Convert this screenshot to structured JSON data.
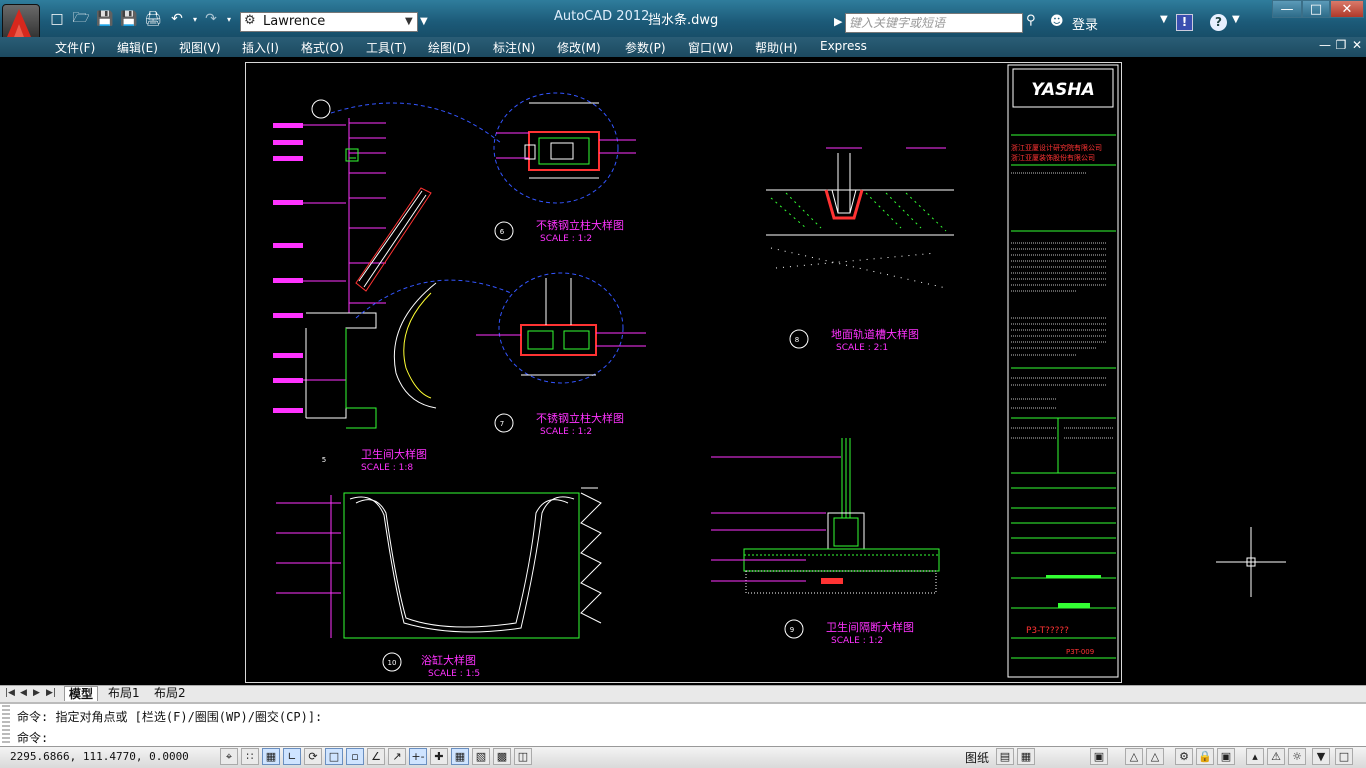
{
  "titlebar": {
    "workspace": "Lawrence",
    "app_title": "AutoCAD 2012",
    "file_title": "挡水条.dwg",
    "search_placeholder": "键入关键字或短语",
    "login_label": "登录",
    "exchange_label": "!",
    "help_label": "?"
  },
  "menus": [
    "文件(F)",
    "编辑(E)",
    "视图(V)",
    "插入(I)",
    "格式(O)",
    "工具(T)",
    "绘图(D)",
    "标注(N)",
    "修改(M)",
    "参数(P)",
    "窗口(W)",
    "帮助(H)",
    "Express"
  ],
  "drawing": {
    "details": [
      {
        "no": "6",
        "title": "不锈钢立柱大样图",
        "scale": "SCALE : 1:2"
      },
      {
        "no": "7",
        "title": "不锈钢立柱大样图",
        "scale": "SCALE : 1:2"
      },
      {
        "no": "8",
        "title": "地面轨道槽大样图",
        "scale": "SCALE : 2:1"
      },
      {
        "no": "5",
        "title": "卫生间大样图",
        "scale": "SCALE : 1:8"
      },
      {
        "no": "9",
        "title": "卫生间隔断大样图",
        "scale": "SCALE : 1:2"
      },
      {
        "no": "10",
        "title": "浴缸大样图",
        "scale": "SCALE : 1:5"
      }
    ],
    "titleblock": {
      "logo": "YASHA",
      "company_1": "浙江亚厦设计研究院有限公司",
      "company_2": "浙江亚厦装饰股份有限公司",
      "drawing_no": "P3-T?????",
      "project_no": "P3T-009"
    }
  },
  "tabs": [
    "模型",
    "布局1",
    "布局2"
  ],
  "command": {
    "history": "命令: 指定对角点或 [栏选(F)/圈围(WP)/圈交(CP)]:",
    "prompt": "命令:"
  },
  "status": {
    "coords": "2295.6866, 111.4770, 0.0000",
    "paper_label": "图纸"
  },
  "colors": {
    "magenta": "#ff33ff",
    "green": "#33ff33",
    "blue": "#3355ff",
    "red": "#ff3333",
    "white": "#ffffff",
    "yellow": "#ffff33"
  }
}
